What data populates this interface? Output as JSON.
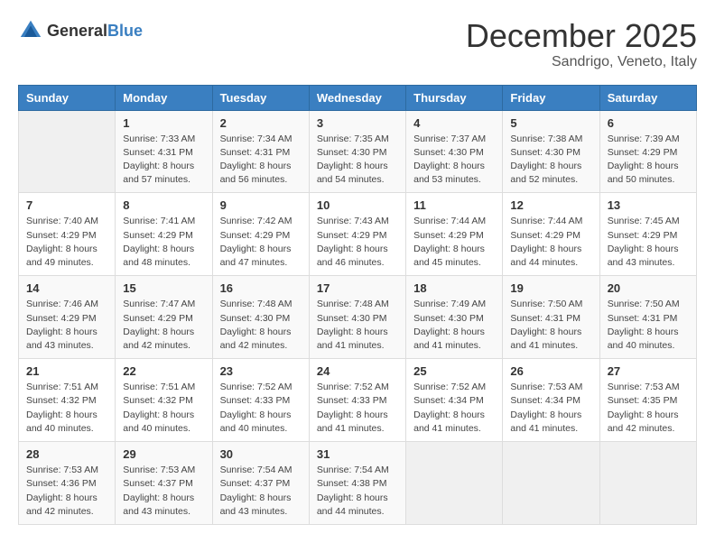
{
  "logo": {
    "general": "General",
    "blue": "Blue"
  },
  "title": "December 2025",
  "location": "Sandrigo, Veneto, Italy",
  "days_header": [
    "Sunday",
    "Monday",
    "Tuesday",
    "Wednesday",
    "Thursday",
    "Friday",
    "Saturday"
  ],
  "weeks": [
    [
      {
        "day": "",
        "info": ""
      },
      {
        "day": "1",
        "info": "Sunrise: 7:33 AM\nSunset: 4:31 PM\nDaylight: 8 hours\nand 57 minutes."
      },
      {
        "day": "2",
        "info": "Sunrise: 7:34 AM\nSunset: 4:31 PM\nDaylight: 8 hours\nand 56 minutes."
      },
      {
        "day": "3",
        "info": "Sunrise: 7:35 AM\nSunset: 4:30 PM\nDaylight: 8 hours\nand 54 minutes."
      },
      {
        "day": "4",
        "info": "Sunrise: 7:37 AM\nSunset: 4:30 PM\nDaylight: 8 hours\nand 53 minutes."
      },
      {
        "day": "5",
        "info": "Sunrise: 7:38 AM\nSunset: 4:30 PM\nDaylight: 8 hours\nand 52 minutes."
      },
      {
        "day": "6",
        "info": "Sunrise: 7:39 AM\nSunset: 4:29 PM\nDaylight: 8 hours\nand 50 minutes."
      }
    ],
    [
      {
        "day": "7",
        "info": "Sunrise: 7:40 AM\nSunset: 4:29 PM\nDaylight: 8 hours\nand 49 minutes."
      },
      {
        "day": "8",
        "info": "Sunrise: 7:41 AM\nSunset: 4:29 PM\nDaylight: 8 hours\nand 48 minutes."
      },
      {
        "day": "9",
        "info": "Sunrise: 7:42 AM\nSunset: 4:29 PM\nDaylight: 8 hours\nand 47 minutes."
      },
      {
        "day": "10",
        "info": "Sunrise: 7:43 AM\nSunset: 4:29 PM\nDaylight: 8 hours\nand 46 minutes."
      },
      {
        "day": "11",
        "info": "Sunrise: 7:44 AM\nSunset: 4:29 PM\nDaylight: 8 hours\nand 45 minutes."
      },
      {
        "day": "12",
        "info": "Sunrise: 7:44 AM\nSunset: 4:29 PM\nDaylight: 8 hours\nand 44 minutes."
      },
      {
        "day": "13",
        "info": "Sunrise: 7:45 AM\nSunset: 4:29 PM\nDaylight: 8 hours\nand 43 minutes."
      }
    ],
    [
      {
        "day": "14",
        "info": "Sunrise: 7:46 AM\nSunset: 4:29 PM\nDaylight: 8 hours\nand 43 minutes."
      },
      {
        "day": "15",
        "info": "Sunrise: 7:47 AM\nSunset: 4:29 PM\nDaylight: 8 hours\nand 42 minutes."
      },
      {
        "day": "16",
        "info": "Sunrise: 7:48 AM\nSunset: 4:30 PM\nDaylight: 8 hours\nand 42 minutes."
      },
      {
        "day": "17",
        "info": "Sunrise: 7:48 AM\nSunset: 4:30 PM\nDaylight: 8 hours\nand 41 minutes."
      },
      {
        "day": "18",
        "info": "Sunrise: 7:49 AM\nSunset: 4:30 PM\nDaylight: 8 hours\nand 41 minutes."
      },
      {
        "day": "19",
        "info": "Sunrise: 7:50 AM\nSunset: 4:31 PM\nDaylight: 8 hours\nand 41 minutes."
      },
      {
        "day": "20",
        "info": "Sunrise: 7:50 AM\nSunset: 4:31 PM\nDaylight: 8 hours\nand 40 minutes."
      }
    ],
    [
      {
        "day": "21",
        "info": "Sunrise: 7:51 AM\nSunset: 4:32 PM\nDaylight: 8 hours\nand 40 minutes."
      },
      {
        "day": "22",
        "info": "Sunrise: 7:51 AM\nSunset: 4:32 PM\nDaylight: 8 hours\nand 40 minutes."
      },
      {
        "day": "23",
        "info": "Sunrise: 7:52 AM\nSunset: 4:33 PM\nDaylight: 8 hours\nand 40 minutes."
      },
      {
        "day": "24",
        "info": "Sunrise: 7:52 AM\nSunset: 4:33 PM\nDaylight: 8 hours\nand 41 minutes."
      },
      {
        "day": "25",
        "info": "Sunrise: 7:52 AM\nSunset: 4:34 PM\nDaylight: 8 hours\nand 41 minutes."
      },
      {
        "day": "26",
        "info": "Sunrise: 7:53 AM\nSunset: 4:34 PM\nDaylight: 8 hours\nand 41 minutes."
      },
      {
        "day": "27",
        "info": "Sunrise: 7:53 AM\nSunset: 4:35 PM\nDaylight: 8 hours\nand 42 minutes."
      }
    ],
    [
      {
        "day": "28",
        "info": "Sunrise: 7:53 AM\nSunset: 4:36 PM\nDaylight: 8 hours\nand 42 minutes."
      },
      {
        "day": "29",
        "info": "Sunrise: 7:53 AM\nSunset: 4:37 PM\nDaylight: 8 hours\nand 43 minutes."
      },
      {
        "day": "30",
        "info": "Sunrise: 7:54 AM\nSunset: 4:37 PM\nDaylight: 8 hours\nand 43 minutes."
      },
      {
        "day": "31",
        "info": "Sunrise: 7:54 AM\nSunset: 4:38 PM\nDaylight: 8 hours\nand 44 minutes."
      },
      {
        "day": "",
        "info": ""
      },
      {
        "day": "",
        "info": ""
      },
      {
        "day": "",
        "info": ""
      }
    ]
  ]
}
